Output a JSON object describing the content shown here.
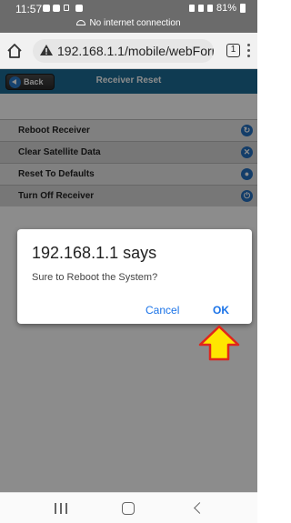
{
  "status_bar": {
    "time": "11:57",
    "battery": "81%",
    "network_message": "No internet connection"
  },
  "browser": {
    "url": "192.168.1.1/mobile/webForr",
    "tab_count": "1"
  },
  "app": {
    "back_label": "Back",
    "title": "Receiver Reset",
    "header_color": "#1c6c96",
    "items": [
      {
        "label": "Reboot Receiver",
        "icon": "refresh-icon"
      },
      {
        "label": "Clear Satellite Data",
        "icon": "close-circle-icon"
      },
      {
        "label": "Reset To Defaults",
        "icon": "reset-circle-icon"
      },
      {
        "label": "Turn Off Receiver",
        "icon": "power-icon"
      }
    ]
  },
  "dialog": {
    "title": "192.168.1.1 says",
    "message": "Sure to Reboot the System?",
    "cancel_label": "Cancel",
    "ok_label": "OK",
    "accent_color": "#1a73e8"
  },
  "annotation": {
    "arrow_color": "#ffe600",
    "arrow_border": "#e0261c"
  }
}
